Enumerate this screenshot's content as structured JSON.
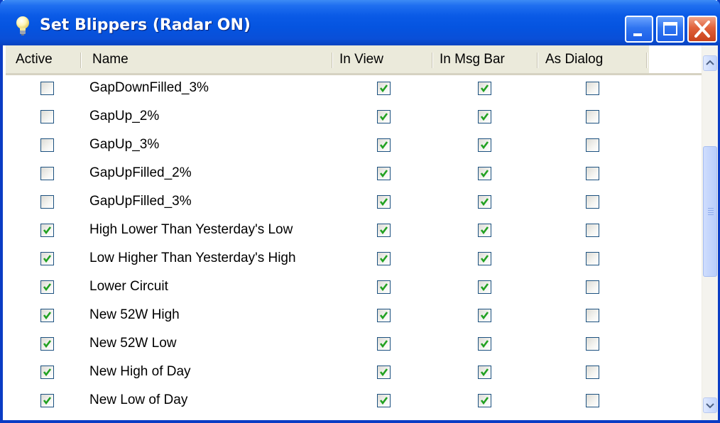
{
  "window": {
    "title": "Set Blippers (Radar ON)",
    "title_icon": "lightbulb-icon",
    "accent": "#0a5ae6",
    "close_color": "#e0613a"
  },
  "columns": {
    "active": "Active",
    "name": "Name",
    "in_view": "In View",
    "in_msg_bar": "In Msg Bar",
    "as_dialog": "As Dialog"
  },
  "rows": [
    {
      "name": "GapDownFilled_3%",
      "active": false,
      "in_view": true,
      "in_msg_bar": true,
      "as_dialog": false
    },
    {
      "name": "GapUp_2%",
      "active": false,
      "in_view": true,
      "in_msg_bar": true,
      "as_dialog": false
    },
    {
      "name": "GapUp_3%",
      "active": false,
      "in_view": true,
      "in_msg_bar": true,
      "as_dialog": false
    },
    {
      "name": "GapUpFilled_2%",
      "active": false,
      "in_view": true,
      "in_msg_bar": true,
      "as_dialog": false
    },
    {
      "name": "GapUpFilled_3%",
      "active": false,
      "in_view": true,
      "in_msg_bar": true,
      "as_dialog": false
    },
    {
      "name": "High Lower Than Yesterday's Low",
      "active": true,
      "in_view": true,
      "in_msg_bar": true,
      "as_dialog": false
    },
    {
      "name": "Low Higher Than Yesterday's High",
      "active": true,
      "in_view": true,
      "in_msg_bar": true,
      "as_dialog": false
    },
    {
      "name": "Lower Circuit",
      "active": true,
      "in_view": true,
      "in_msg_bar": true,
      "as_dialog": false
    },
    {
      "name": "New 52W High",
      "active": true,
      "in_view": true,
      "in_msg_bar": true,
      "as_dialog": false
    },
    {
      "name": "New 52W Low",
      "active": true,
      "in_view": true,
      "in_msg_bar": true,
      "as_dialog": false
    },
    {
      "name": "New High of Day",
      "active": true,
      "in_view": true,
      "in_msg_bar": true,
      "as_dialog": false
    },
    {
      "name": "New Low of Day",
      "active": true,
      "in_view": true,
      "in_msg_bar": true,
      "as_dialog": false
    }
  ],
  "check_color": "#21a121"
}
